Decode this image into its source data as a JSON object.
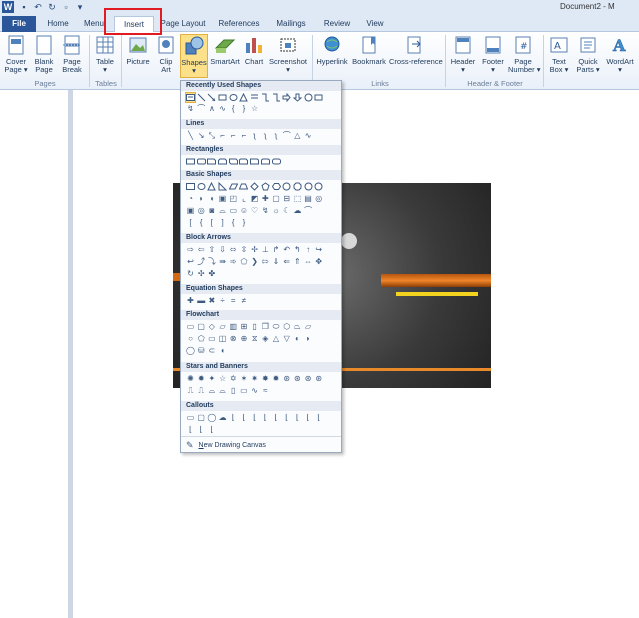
{
  "window": {
    "title": "Document2 - M"
  },
  "quick_access": {
    "icons": [
      "word-logo-icon",
      "save-icon",
      "undo-icon",
      "redo-icon",
      "new-icon",
      "customize-icon"
    ]
  },
  "tabs": [
    {
      "label": "File"
    },
    {
      "label": "Home"
    },
    {
      "label": "Menu"
    },
    {
      "label": "Insert"
    },
    {
      "label": "Page Layout"
    },
    {
      "label": "References"
    },
    {
      "label": "Mailings"
    },
    {
      "label": "Review"
    },
    {
      "label": "View"
    }
  ],
  "ribbon": {
    "buttons": [
      {
        "label1": "Cover",
        "label2": "Page ▾"
      },
      {
        "label1": "Blank",
        "label2": "Page"
      },
      {
        "label1": "Page",
        "label2": "Break"
      },
      {
        "label1": "Table",
        "label2": "▾"
      },
      {
        "label1": "Picture",
        "label2": ""
      },
      {
        "label1": "Clip",
        "label2": "Art"
      },
      {
        "label1": "Shapes",
        "label2": "▾"
      },
      {
        "label1": "SmartArt",
        "label2": ""
      },
      {
        "label1": "Chart",
        "label2": ""
      },
      {
        "label1": "Screenshot",
        "label2": "▾"
      },
      {
        "label1": "Hyperlink",
        "label2": ""
      },
      {
        "label1": "Bookmark",
        "label2": ""
      },
      {
        "label1": "Cross-reference",
        "label2": ""
      },
      {
        "label1": "Header",
        "label2": "▾"
      },
      {
        "label1": "Footer",
        "label2": "▾"
      },
      {
        "label1": "Page",
        "label2": "Number ▾"
      },
      {
        "label1": "Text",
        "label2": "Box ▾"
      },
      {
        "label1": "Quick",
        "label2": "Parts ▾"
      },
      {
        "label1": "WordArt",
        "label2": "▾"
      }
    ],
    "groups": [
      "Pages",
      "Tables",
      "Links",
      "Header & Footer"
    ]
  },
  "shapes_menu": {
    "sections": [
      {
        "title": "Recently Used Shapes"
      },
      {
        "title": "Lines"
      },
      {
        "title": "Rectangles"
      },
      {
        "title": "Basic Shapes"
      },
      {
        "title": "Block Arrows"
      },
      {
        "title": "Equation Shapes"
      },
      {
        "title": "Flowchart"
      },
      {
        "title": "Stars and Banners"
      },
      {
        "title": "Callouts"
      }
    ],
    "new_canvas_prefix": "N",
    "new_canvas_rest": "ew Drawing Canvas"
  },
  "colors": {
    "file_tab": "#2b579a",
    "highlight": "#e01b22",
    "accent_orange": "#e88a2a",
    "selected": "#fce08a"
  }
}
